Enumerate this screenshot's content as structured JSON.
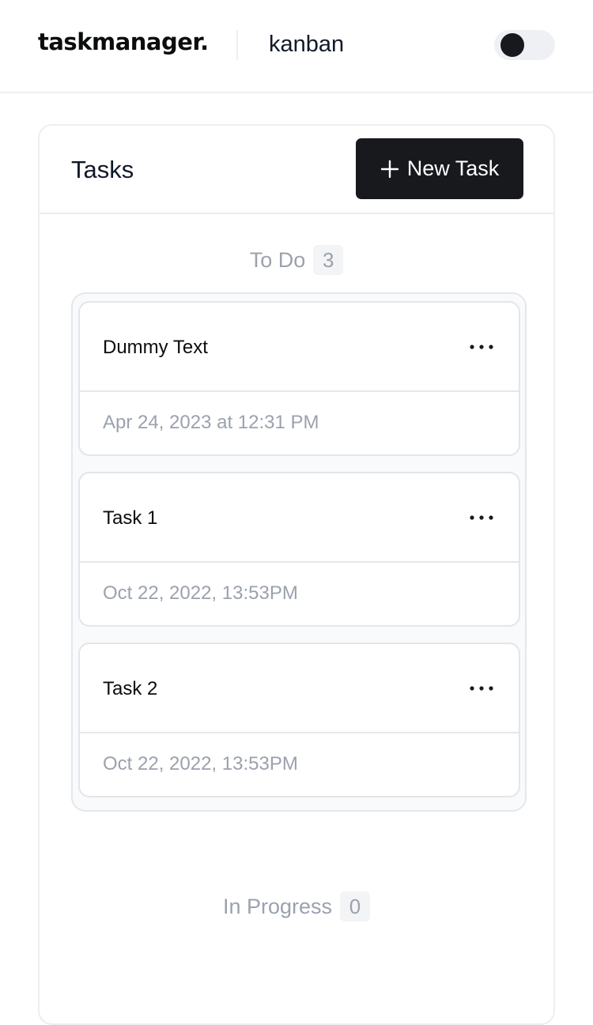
{
  "header": {
    "logo": "taskmanager.",
    "board_name": "kanban",
    "theme_toggle": "dark"
  },
  "panel": {
    "title": "Tasks",
    "new_task_label": "New Task"
  },
  "columns": [
    {
      "title": "To Do",
      "count": "3",
      "tasks": [
        {
          "title": "Dummy Text",
          "date": "Apr 24, 2023 at 12:31 PM"
        },
        {
          "title": "Task 1",
          "date": "Oct 22, 2022, 13:53PM"
        },
        {
          "title": "Task 2",
          "date": "Oct 22, 2022, 13:53PM"
        }
      ]
    },
    {
      "title": "In Progress",
      "count": "0",
      "tasks": []
    }
  ],
  "colors": {
    "accent": "#17191d",
    "muted_text": "#9ba1ad",
    "border": "#eceef1"
  },
  "icons": {
    "new_task": "plus-icon",
    "task_menu": "more-horizontal-icon",
    "theme": "toggle-knob"
  }
}
